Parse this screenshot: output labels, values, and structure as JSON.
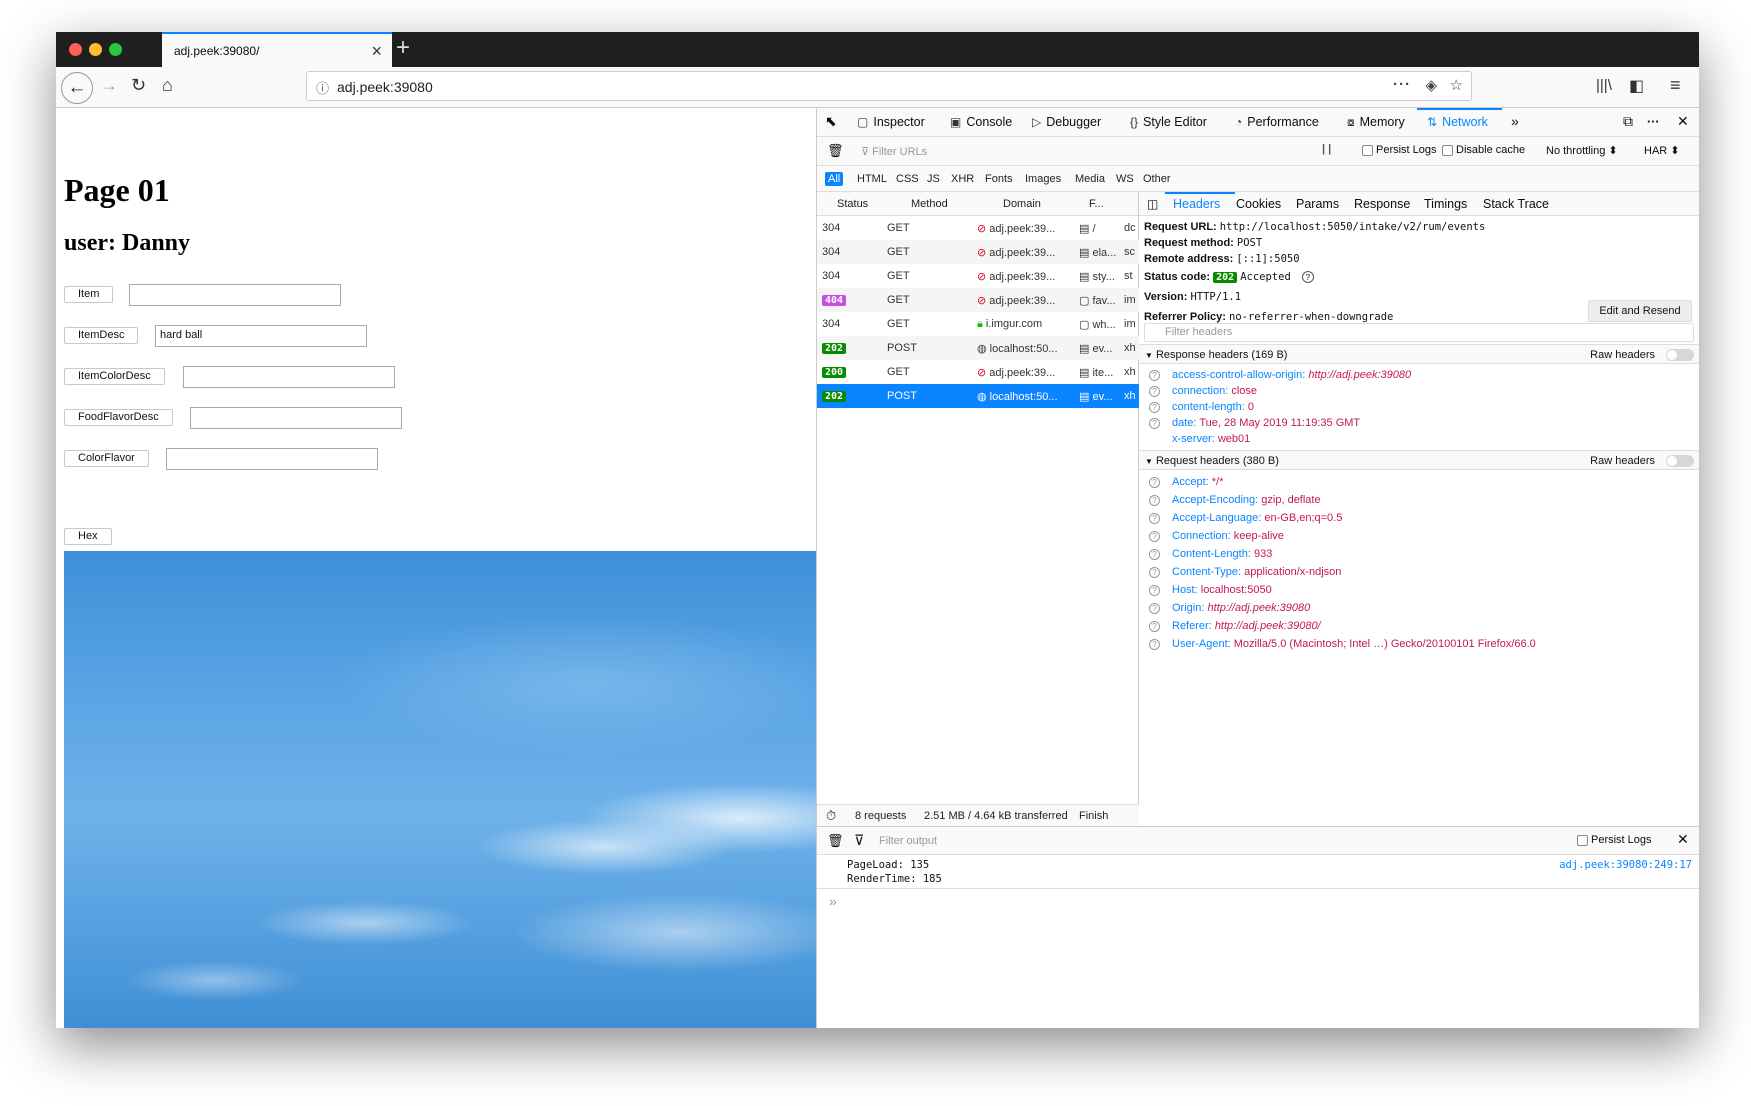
{
  "browser": {
    "tab_title": "adj.peek:39080/",
    "url": "adj.peek:39080"
  },
  "page": {
    "title": "Page 01",
    "user_line": "user: Danny",
    "fields": [
      {
        "label": "Item",
        "value": ""
      },
      {
        "label": "ItemDesc",
        "value": "hard ball"
      },
      {
        "label": "ItemColorDesc",
        "value": ""
      },
      {
        "label": "FoodFlavorDesc",
        "value": ""
      },
      {
        "label": "ColorFlavor",
        "value": ""
      }
    ],
    "hex_button": "Hex"
  },
  "devtools": {
    "tabs": [
      "Inspector",
      "Console",
      "Debugger",
      "Style Editor",
      "Performance",
      "Memory",
      "Network"
    ],
    "active_tab": "Network",
    "filter_urls_placeholder": "Filter URLs",
    "persist_logs": "Persist Logs",
    "disable_cache": "Disable cache",
    "throttling": "No throttling ⬍",
    "har": "HAR ⬍",
    "type_filters": [
      "All",
      "HTML",
      "CSS",
      "JS",
      "XHR",
      "Fonts",
      "Images",
      "Media",
      "WS",
      "Other"
    ],
    "columns": [
      "Status",
      "Method",
      "Domain",
      "F..."
    ],
    "requests": [
      {
        "status": "304",
        "method": "GET",
        "domain": "adj.peek:39...",
        "file": "/",
        "type": "dc"
      },
      {
        "status": "304",
        "method": "GET",
        "domain": "adj.peek:39...",
        "file": "ela...",
        "type": "sc"
      },
      {
        "status": "304",
        "method": "GET",
        "domain": "adj.peek:39...",
        "file": "sty...",
        "type": "st"
      },
      {
        "status": "404",
        "method": "GET",
        "domain": "adj.peek:39...",
        "file": "fav...",
        "type": "im"
      },
      {
        "status": "304",
        "method": "GET",
        "domain": "i.imgur.com",
        "file": "wh...",
        "type": "im"
      },
      {
        "status": "202",
        "method": "POST",
        "domain": "localhost:50...",
        "file": "ev...",
        "type": "xh"
      },
      {
        "status": "200",
        "method": "GET",
        "domain": "adj.peek:39...",
        "file": "ite...",
        "type": "xh"
      },
      {
        "status": "202",
        "method": "POST",
        "domain": "localhost:50...",
        "file": "ev...",
        "type": "xh"
      }
    ],
    "summary": {
      "requests": "8 requests",
      "size": "2.51 MB / 4.64 kB transferred",
      "finish": "Finish"
    },
    "detail_tabs": [
      "Headers",
      "Cookies",
      "Params",
      "Response",
      "Timings",
      "Stack Trace"
    ],
    "request_url_label": "Request URL:",
    "request_url": "http://localhost:5050/intake/v2/rum/events",
    "request_method_label": "Request method:",
    "request_method": "POST",
    "remote_address_label": "Remote address:",
    "remote_address": "[::1]:5050",
    "status_code_label": "Status code:",
    "status_code": "202",
    "status_text": "Accepted",
    "version_label": "Version:",
    "version": "HTTP/1.1",
    "referrer_policy_label": "Referrer Policy:",
    "referrer_policy": "no-referrer-when-downgrade",
    "edit_resend": "Edit and Resend",
    "filter_headers": "Filter headers",
    "raw_headers": "Raw headers",
    "response_headers_title": "Response headers (169 B)",
    "response_headers": [
      {
        "name": "access-control-allow-origin:",
        "value": "http://adj.peek:39080"
      },
      {
        "name": "connection:",
        "value": "close"
      },
      {
        "name": "content-length:",
        "value": "0"
      },
      {
        "name": "date:",
        "value": "Tue, 28 May 2019 11:19:35 GMT"
      },
      {
        "name": "x-server:",
        "value": "web01"
      }
    ],
    "request_headers_title": "Request headers (380 B)",
    "request_headers": [
      {
        "name": "Accept:",
        "value": "*/*"
      },
      {
        "name": "Accept-Encoding:",
        "value": "gzip, deflate"
      },
      {
        "name": "Accept-Language:",
        "value": "en-GB,en;q=0.5"
      },
      {
        "name": "Connection:",
        "value": "keep-alive"
      },
      {
        "name": "Content-Length:",
        "value": "933"
      },
      {
        "name": "Content-Type:",
        "value": "application/x-ndjson"
      },
      {
        "name": "Host:",
        "value": "localhost:5050"
      },
      {
        "name": "Origin:",
        "value": "http://adj.peek:39080"
      },
      {
        "name": "Referer:",
        "value": "http://adj.peek:39080/"
      },
      {
        "name": "User-Agent:",
        "value": "Mozilla/5.0 (Macintosh; Intel …) Gecko/20100101 Firefox/66.0"
      }
    ],
    "console": {
      "filter_placeholder": "Filter output",
      "persist_logs": "Persist Logs",
      "line1": "PageLoad: 135",
      "line2": "RenderTime: 185",
      "source": "adj.peek:39080:249:17",
      "prompt": "»"
    }
  },
  "colors": {
    "accent": "#0a84ff",
    "status_ok": "#058b00",
    "status_404": "#c44fe0",
    "header_value": "#c2185b"
  }
}
